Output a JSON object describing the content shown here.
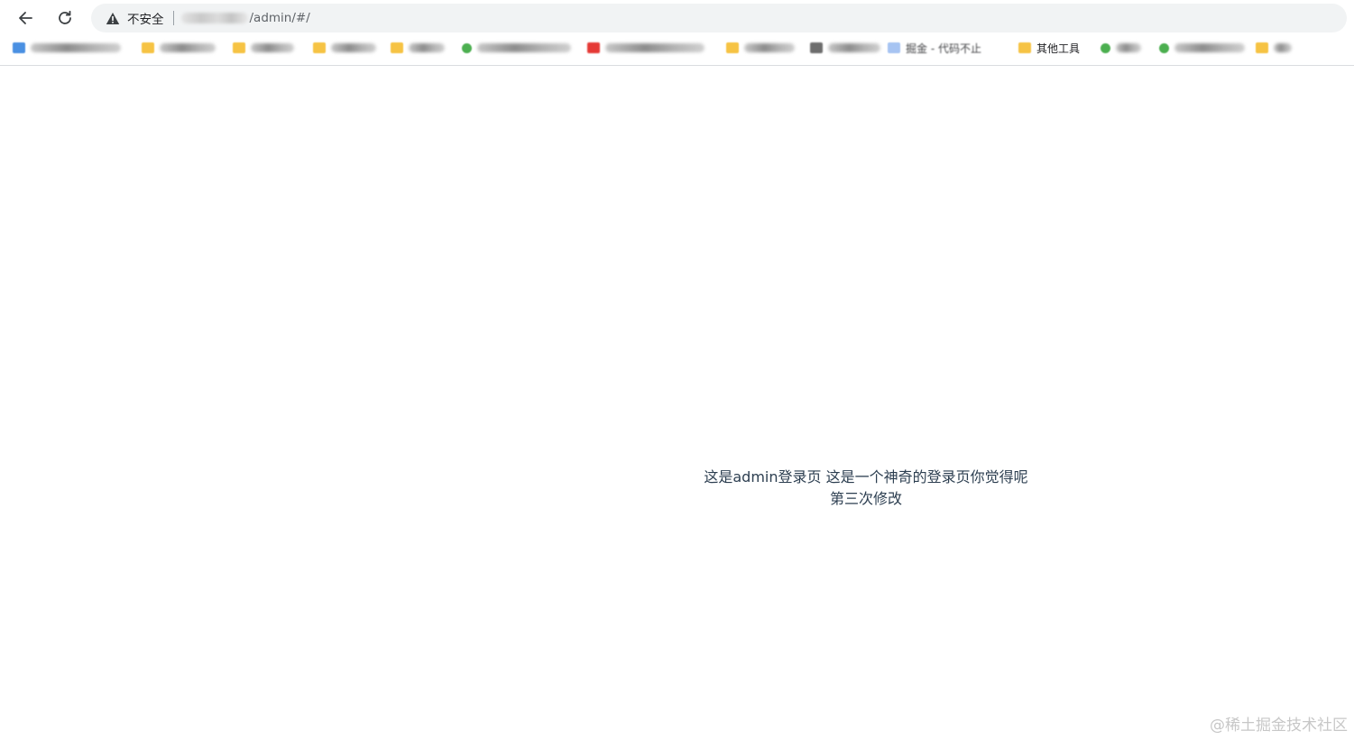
{
  "toolbar": {
    "back_icon": "arrow-left-icon",
    "reload_icon": "reload-icon"
  },
  "omnibox": {
    "security_label": "不安全",
    "url_path": "/admin/#/"
  },
  "bookmarks": [
    {
      "icon": "blue",
      "text": ""
    },
    {
      "icon": "folder",
      "text": ""
    },
    {
      "icon": "folder",
      "text": ""
    },
    {
      "icon": "folder",
      "text": ""
    },
    {
      "icon": "folder",
      "text": ""
    },
    {
      "icon": "green",
      "text": ""
    },
    {
      "icon": "red",
      "text": ""
    },
    {
      "icon": "folder",
      "text": ""
    },
    {
      "icon": "gray",
      "text": ""
    },
    {
      "icon": "lightblue",
      "text": "掘金 - 代码不止"
    },
    {
      "icon": "folder",
      "text": "其他工具"
    },
    {
      "icon": "green",
      "text": ""
    },
    {
      "icon": "green",
      "text": ""
    },
    {
      "icon": "folder",
      "text": ""
    }
  ],
  "page": {
    "line1": "这是admin登录页 这是一个神奇的登录页你觉得呢",
    "line2": "第三次修改"
  },
  "watermark": "@稀土掘金技术社区",
  "colors": {
    "page_text": "#2c3e50",
    "omnibox_bg": "#f1f3f4",
    "folder": "#f6c344"
  }
}
